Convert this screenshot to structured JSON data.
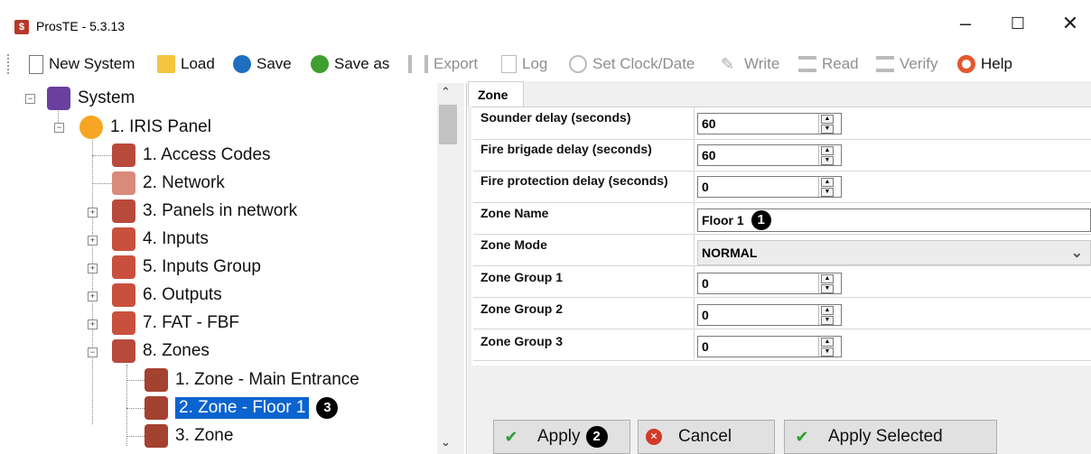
{
  "window": {
    "title": "ProsTE - 5.3.13"
  },
  "toolbar": {
    "items": [
      {
        "label": "New System",
        "icon": "new-document-icon"
      },
      {
        "label": "Load",
        "icon": "folder-icon"
      },
      {
        "label": "Save",
        "icon": "save-icon"
      },
      {
        "label": "Save as",
        "icon": "save-as-icon"
      },
      {
        "label": "Export",
        "icon": "export-icon"
      },
      {
        "label": "Log",
        "icon": "log-icon"
      },
      {
        "label": "Set Clock/Date",
        "icon": "clock-icon"
      },
      {
        "label": "Write",
        "icon": "pencil-icon"
      },
      {
        "label": "Read",
        "icon": "read-icon"
      },
      {
        "label": "Verify",
        "icon": "verify-icon"
      },
      {
        "label": "Help",
        "icon": "help-lifebuoy-icon"
      }
    ]
  },
  "tree": {
    "root": "System",
    "panel": "1. IRIS Panel",
    "items": [
      "1. Access Codes",
      "2. Network",
      "3. Panels in network",
      "4. Inputs",
      "5. Inputs Group",
      "6. Outputs",
      "7. FAT - FBF",
      "8. Zones"
    ],
    "zones": [
      "1. Zone - Main Entrance",
      "2. Zone - Floor 1",
      "3. Zone"
    ],
    "selected": "2. Zone - Floor 1",
    "badge": "3"
  },
  "panel": {
    "tab": "Zone",
    "rows": [
      {
        "label": "Sounder delay (seconds)",
        "value": "60"
      },
      {
        "label": "Fire brigade delay (seconds)",
        "value": "60"
      },
      {
        "label": "Fire protection delay (seconds)",
        "value": "0"
      },
      {
        "label": "Zone Name",
        "value": "Floor 1"
      },
      {
        "label": "Zone Mode",
        "value": "NORMAL"
      },
      {
        "label": "Zone Group 1",
        "value": "0"
      },
      {
        "label": "Zone Group 2",
        "value": "0"
      },
      {
        "label": "Zone Group 3",
        "value": "0"
      }
    ],
    "zone_name_badge": "1"
  },
  "buttons": {
    "apply": "Apply",
    "apply_badge": "2",
    "cancel": "Cancel",
    "apply_selected": "Apply Selected"
  },
  "colors": {
    "selection": "#0a63cf",
    "node_icon": "#b84a3c",
    "apply_check": "#2e9e2e",
    "cancel_icon": "#d23a2a"
  }
}
